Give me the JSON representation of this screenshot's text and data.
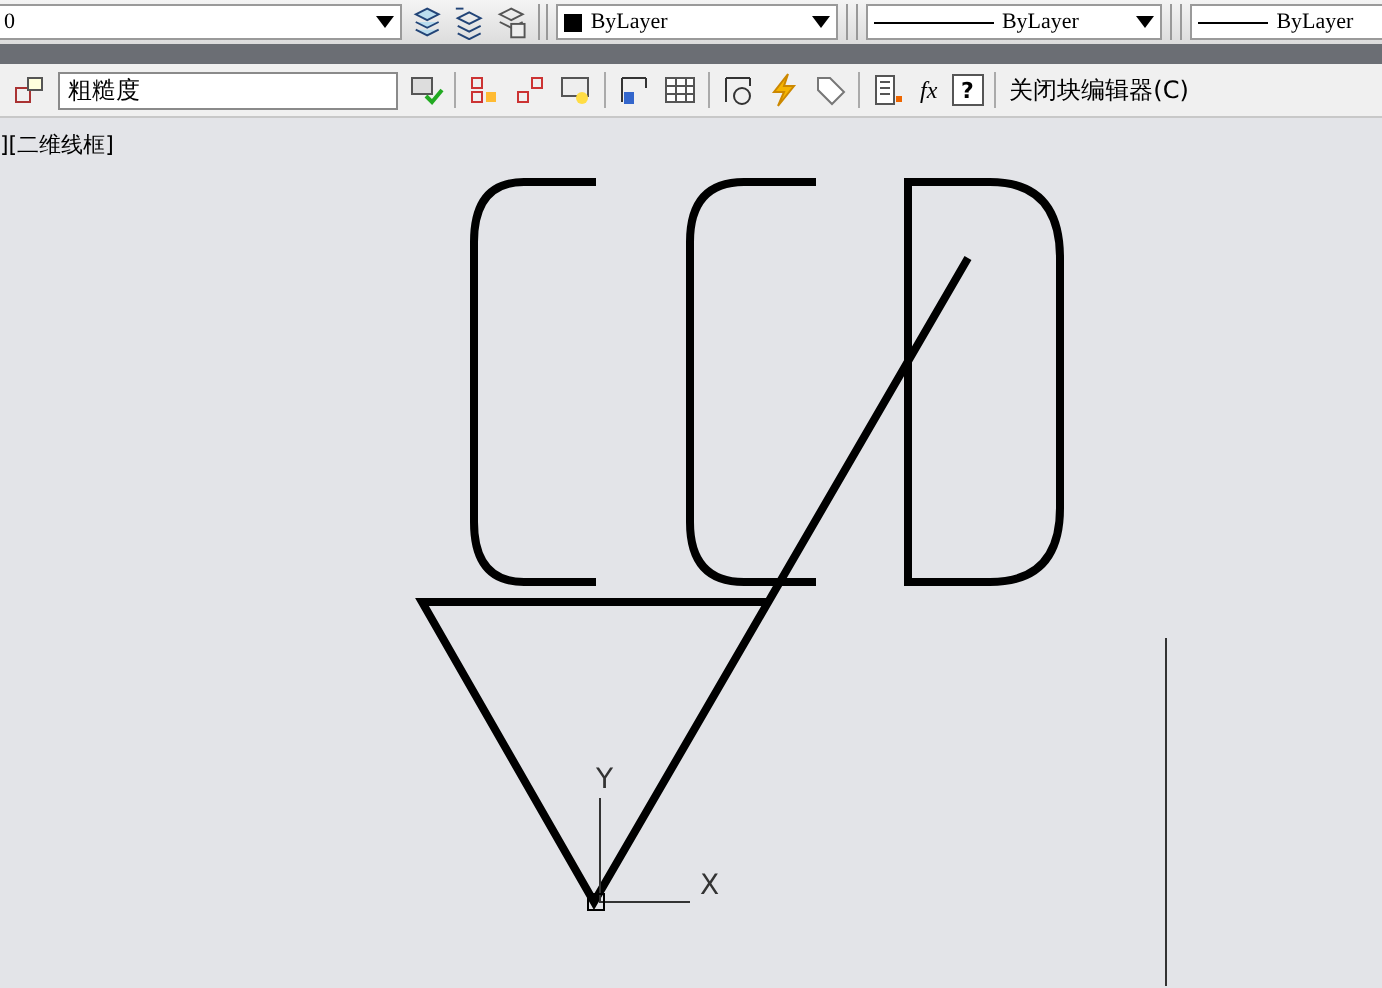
{
  "properties_toolbar": {
    "layer": "0",
    "color_setting": "ByLayer",
    "linetype": "ByLayer",
    "lineweight": "ByLayer"
  },
  "block_editor_toolbar": {
    "block_name": "粗糙度",
    "close_button": "关闭块编辑器(C)",
    "help_button": "?",
    "function_button": "fx"
  },
  "viewport_label": "][二维线框]",
  "ucs": {
    "y_label": "Y",
    "x_label": "X"
  }
}
